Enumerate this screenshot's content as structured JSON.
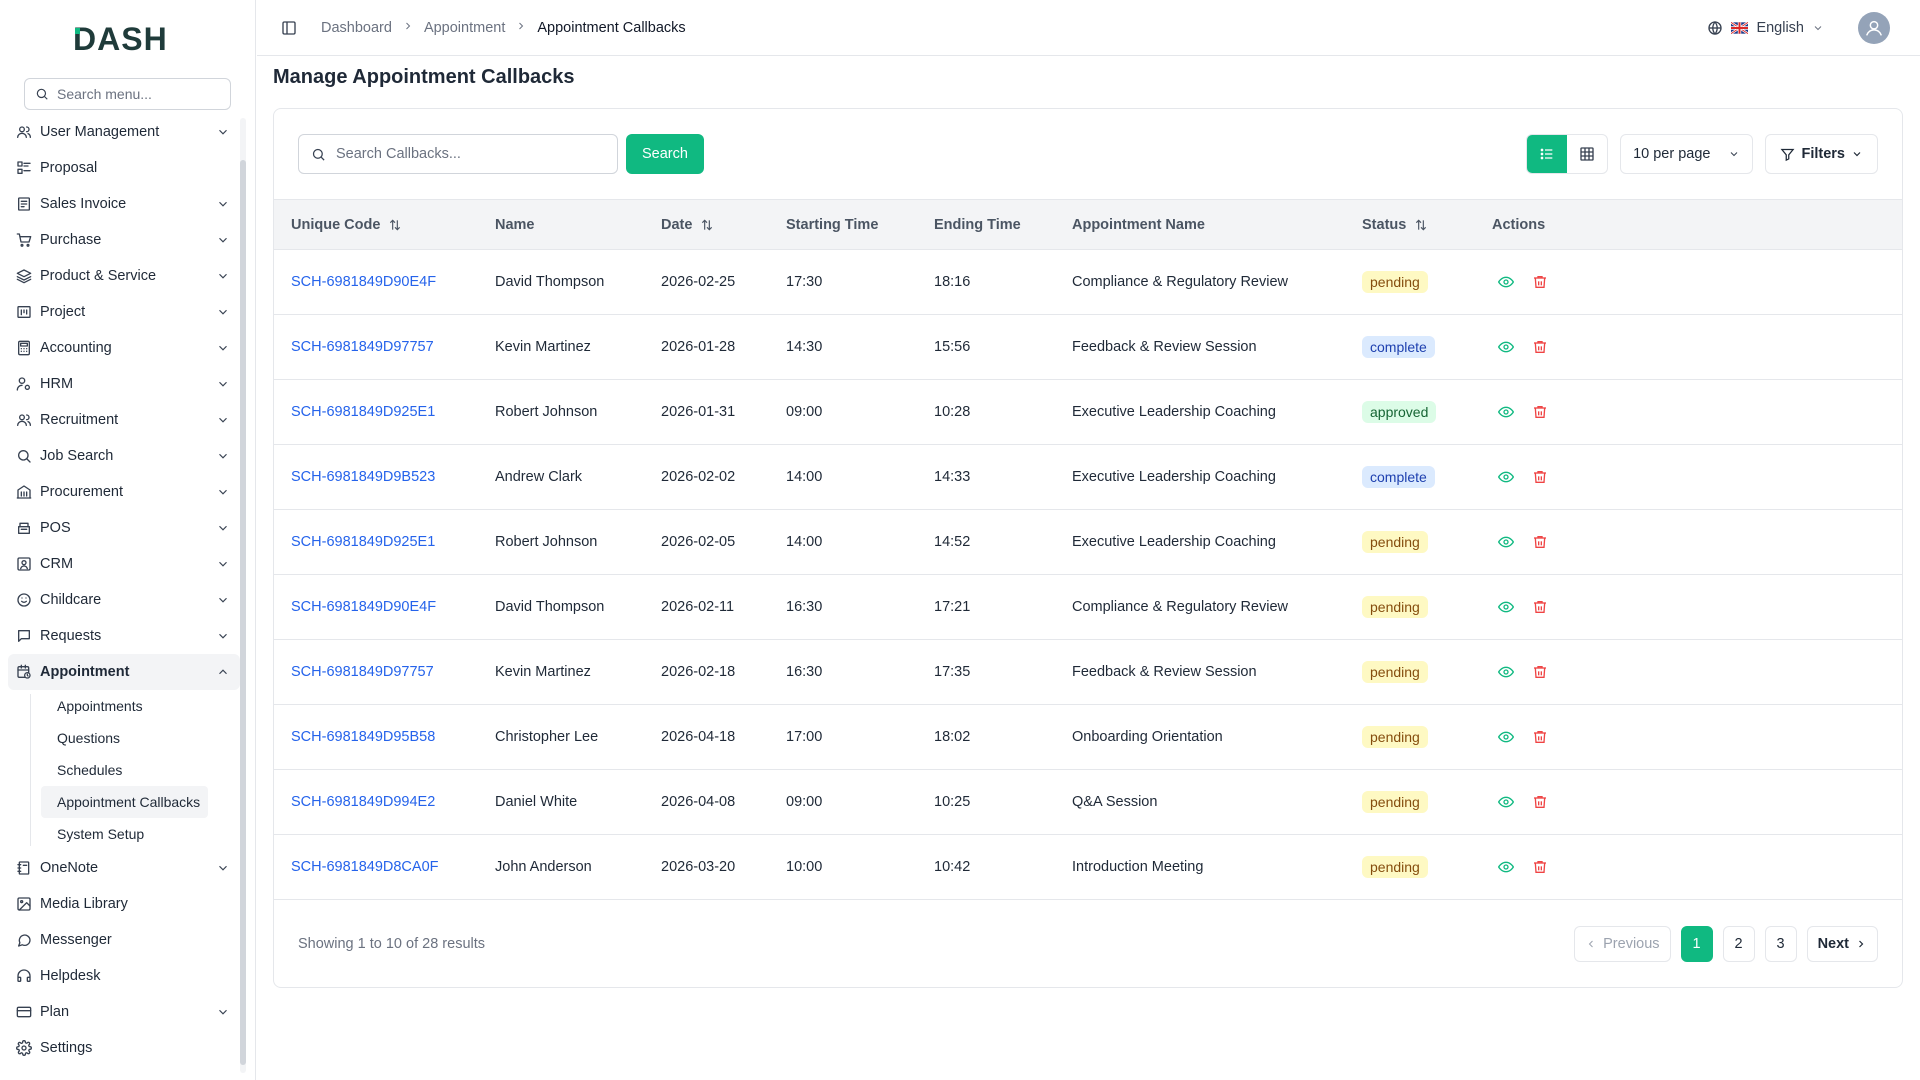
{
  "brand": "DASH",
  "sidebar": {
    "search_placeholder": "Search menu...",
    "items": [
      {
        "label": "User Management",
        "icon": "users-icon",
        "chevron": true
      },
      {
        "label": "Proposal",
        "icon": "proposal-icon",
        "chevron": false
      },
      {
        "label": "Sales Invoice",
        "icon": "invoice-icon",
        "chevron": true
      },
      {
        "label": "Purchase",
        "icon": "cart-icon",
        "chevron": true
      },
      {
        "label": "Product & Service",
        "icon": "layers-icon",
        "chevron": true
      },
      {
        "label": "Project",
        "icon": "folder-icon",
        "chevron": true
      },
      {
        "label": "Accounting",
        "icon": "calculator-icon",
        "chevron": true
      },
      {
        "label": "HRM",
        "icon": "user-cog-icon",
        "chevron": true
      },
      {
        "label": "Recruitment",
        "icon": "users-icon",
        "chevron": true
      },
      {
        "label": "Job Search",
        "icon": "search-icon",
        "chevron": true
      },
      {
        "label": "Procurement",
        "icon": "building-icon",
        "chevron": true
      },
      {
        "label": "POS",
        "icon": "pos-icon",
        "chevron": true
      },
      {
        "label": "CRM",
        "icon": "crm-icon",
        "chevron": true
      },
      {
        "label": "Childcare",
        "icon": "childcare-icon",
        "chevron": true
      },
      {
        "label": "Requests",
        "icon": "message-icon",
        "chevron": true
      },
      {
        "label": "Appointment",
        "icon": "calendar-clock-icon",
        "chevron": true,
        "active": true
      }
    ],
    "appointment_sub": [
      "Appointments",
      "Questions",
      "Schedules",
      "Appointment Callbacks",
      "System Setup"
    ],
    "items_after": [
      {
        "label": "OneNote",
        "icon": "notebook-icon",
        "chevron": true
      },
      {
        "label": "Media Library",
        "icon": "image-icon",
        "chevron": false
      },
      {
        "label": "Messenger",
        "icon": "chat-icon",
        "chevron": false
      },
      {
        "label": "Helpdesk",
        "icon": "headset-icon",
        "chevron": false
      },
      {
        "label": "Plan",
        "icon": "card-icon",
        "chevron": true
      },
      {
        "label": "Settings",
        "icon": "gear-icon",
        "chevron": false
      }
    ]
  },
  "header": {
    "breadcrumbs": [
      "Dashboard",
      "Appointment",
      "Appointment Callbacks"
    ],
    "language": "English"
  },
  "main": {
    "title": "Manage Appointment Callbacks",
    "search_placeholder": "Search Callbacks...",
    "search_button": "Search",
    "per_page": "10 per page",
    "filters": "Filters",
    "columns": [
      "Unique Code",
      "Name",
      "Date",
      "Starting Time",
      "Ending Time",
      "Appointment Name",
      "Status",
      "Actions"
    ],
    "rows": [
      {
        "code": "SCH-6981849D90E4F",
        "name": "David Thompson",
        "date": "2026-02-25",
        "start": "17:30",
        "end": "18:16",
        "appointment": "Compliance & Regulatory Review",
        "status": "pending"
      },
      {
        "code": "SCH-6981849D97757",
        "name": "Kevin Martinez",
        "date": "2026-01-28",
        "start": "14:30",
        "end": "15:56",
        "appointment": "Feedback & Review Session",
        "status": "complete"
      },
      {
        "code": "SCH-6981849D925E1",
        "name": "Robert Johnson",
        "date": "2026-01-31",
        "start": "09:00",
        "end": "10:28",
        "appointment": "Executive Leadership Coaching",
        "status": "approved"
      },
      {
        "code": "SCH-6981849D9B523",
        "name": "Andrew Clark",
        "date": "2026-02-02",
        "start": "14:00",
        "end": "14:33",
        "appointment": "Executive Leadership Coaching",
        "status": "complete"
      },
      {
        "code": "SCH-6981849D925E1",
        "name": "Robert Johnson",
        "date": "2026-02-05",
        "start": "14:00",
        "end": "14:52",
        "appointment": "Executive Leadership Coaching",
        "status": "pending"
      },
      {
        "code": "SCH-6981849D90E4F",
        "name": "David Thompson",
        "date": "2026-02-11",
        "start": "16:30",
        "end": "17:21",
        "appointment": "Compliance & Regulatory Review",
        "status": "pending"
      },
      {
        "code": "SCH-6981849D97757",
        "name": "Kevin Martinez",
        "date": "2026-02-18",
        "start": "16:30",
        "end": "17:35",
        "appointment": "Feedback & Review Session",
        "status": "pending"
      },
      {
        "code": "SCH-6981849D95B58",
        "name": "Christopher Lee",
        "date": "2026-04-18",
        "start": "17:00",
        "end": "18:02",
        "appointment": "Onboarding Orientation",
        "status": "pending"
      },
      {
        "code": "SCH-6981849D994E2",
        "name": "Daniel White",
        "date": "2026-04-08",
        "start": "09:00",
        "end": "10:25",
        "appointment": "Q&A Session",
        "status": "pending"
      },
      {
        "code": "SCH-6981849D8CA0F",
        "name": "John Anderson",
        "date": "2026-03-20",
        "start": "10:00",
        "end": "10:42",
        "appointment": "Introduction Meeting",
        "status": "pending"
      }
    ],
    "showing": "Showing 1 to 10 of 28 results",
    "pagination": {
      "previous": "Previous",
      "pages": [
        "1",
        "2",
        "3"
      ],
      "current": "1",
      "next": "Next"
    }
  },
  "colors": {
    "accent": "#10b981",
    "link": "#2563eb"
  }
}
